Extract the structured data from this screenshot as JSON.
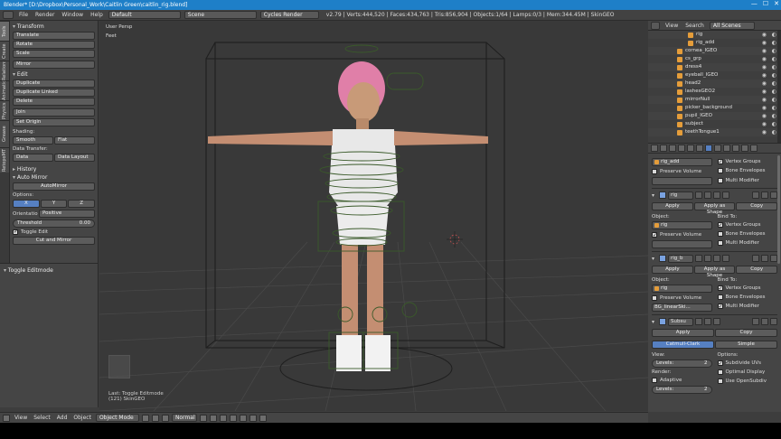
{
  "window": {
    "title": "Blender* [D:\\Dropbox\\Personal_Work\\Caitlin Green\\caitlin_rig.blend]",
    "controls": [
      "—",
      "☐",
      "✕"
    ]
  },
  "info_header": {
    "menus": [
      "File",
      "Render",
      "Window",
      "Help"
    ],
    "layout": "Default",
    "scene": "Scene",
    "engine": "Cycles Render",
    "stats": "v2.79 | Verts:444,520 | Faces:434,763 | Tris:856,904 | Objects:1/64 | Lamps:0/3 | Mem:344.45M | SkinGEO"
  },
  "tool_tabs": [
    "Tools",
    "Create",
    "Relations",
    "Animation",
    "Physics",
    "Grease Pencil",
    "RetopoMT"
  ],
  "tool_shelf": {
    "transform": {
      "title": "Transform",
      "buttons": [
        "Translate",
        "Rotate",
        "Scale"
      ],
      "mirror": "Mirror"
    },
    "edit": {
      "title": "Edit",
      "buttons": [
        "Duplicate",
        "Duplicate Linked",
        "Delete"
      ],
      "join": "Join",
      "set_origin": "Set Origin",
      "shading_label": "Shading:",
      "smooth": "Smooth",
      "flat": "Flat",
      "data_transfer_label": "Data Transfer:",
      "data": "Data",
      "data_layout": "Data Layout"
    },
    "history": "History",
    "auto_mirror": {
      "title": "Auto Mirror",
      "button": "AutoMirror",
      "options_label": "Options:",
      "axes": [
        "X",
        "Y",
        "Z"
      ],
      "orientation_label": "Orientatio",
      "orientation_value": "Positive",
      "threshold_label": "Threshold",
      "threshold_value": "0.00",
      "toggle_edit": "Toggle Edit",
      "cut_mirror": "Cut and Mirror"
    }
  },
  "operator_panel": {
    "title": "Toggle Editmode"
  },
  "viewport": {
    "view_label": "User Persp",
    "unit_label": "Feet",
    "last_op": "Last: Toggle Editmode",
    "status": "(121) SkinGEO"
  },
  "viewport_header": {
    "menus": [
      "View",
      "Select",
      "Add",
      "Object"
    ],
    "mode": "Object Mode",
    "pivot": "Normal"
  },
  "outliner": {
    "tabs": [
      "View",
      "Search"
    ],
    "filter": "All Scenes",
    "rows": [
      {
        "name": "rig",
        "indent": true
      },
      {
        "name": "rig_add",
        "indent": true
      },
      {
        "name": "cornea_IGEO",
        "indent": false
      },
      {
        "name": "cs_grp",
        "indent": false
      },
      {
        "name": "dress4",
        "indent": false
      },
      {
        "name": "eyeball_IGEO",
        "indent": false
      },
      {
        "name": "head2",
        "indent": false
      },
      {
        "name": "lashesGEO2",
        "indent": false
      },
      {
        "name": "mirrorNull",
        "indent": false
      },
      {
        "name": "picker_background",
        "indent": false
      },
      {
        "name": "pupil_IGEO",
        "indent": false
      },
      {
        "name": "subject",
        "indent": false
      },
      {
        "name": "teethTongue1",
        "indent": false
      }
    ]
  },
  "properties": {
    "mod1": {
      "field": "rig_add",
      "vertex_groups": "Vertex Groups",
      "preserve_volume": "Preserve Volume",
      "bone_envelopes": "Bone Envelopes",
      "multi_modifier": "Multi Modifier"
    },
    "mod2": {
      "name": "rig",
      "apply": "Apply",
      "apply_shape": "Apply as Shape",
      "copy": "Copy",
      "object_label": "Object:",
      "object_value": "rig",
      "bind_label": "Bind To:",
      "vertex_groups": "Vertex Groups",
      "preserve_volume": "Preserve Volume",
      "bone_envelopes": "Bone Envelopes",
      "multi_modifier": "Multi Modifier"
    },
    "mod3": {
      "name": "rig_b",
      "apply": "Apply",
      "apply_shape": "Apply as Shape",
      "copy": "Copy",
      "object_label": "Object:",
      "object_value": "rig",
      "bind_label": "Bind To:",
      "vertex_groups": "Vertex Groups",
      "preserve_volume": "Preserve Volume",
      "bone_envelopes": "Bone Envelopes",
      "vgroup_value": "BG_linearSki...",
      "multi_modifier": "Multi Modifier"
    },
    "mod4": {
      "name": "Subsu",
      "apply": "Apply",
      "copy": "Copy",
      "catmull": "Catmull-Clark",
      "simple": "Simple",
      "view_label": "View:",
      "levels_label": "Levels:",
      "levels_view": "2",
      "render_label": "Render:",
      "adaptive": "Adaptive",
      "levels_render": "2",
      "options_label": "Options:",
      "subdivide_uvs": "Subdivide UVs",
      "optimal_display": "Optimal Display",
      "use_opensubdiv": "Use OpenSubdiv"
    }
  }
}
